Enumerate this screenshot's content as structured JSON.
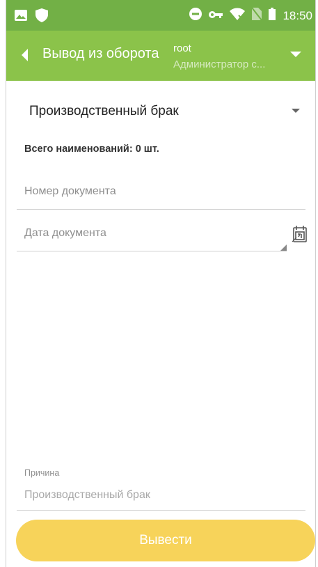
{
  "status_bar": {
    "time": "18:50",
    "icons": [
      "image-icon",
      "shield-icon",
      "do-not-disturb-icon",
      "key-icon",
      "wifi-off-icon",
      "no-sim-icon",
      "battery-icon"
    ]
  },
  "app_bar": {
    "title": "Вывод из оборота",
    "user_name": "root",
    "user_role": "Администратор с..."
  },
  "form": {
    "withdrawal_type": "Производственный брак",
    "total_items": "Всего наименований: 0 шт.",
    "doc_number_placeholder": "Номер документа",
    "doc_date_placeholder": "Дата документа",
    "reason_label": "Причина",
    "reason_placeholder": "Производственный брак",
    "submit_label": "Вывести"
  },
  "colors": {
    "status_bar": "#72b046",
    "app_bar": "#8bc34a",
    "submit_button": "#f7d35a"
  }
}
